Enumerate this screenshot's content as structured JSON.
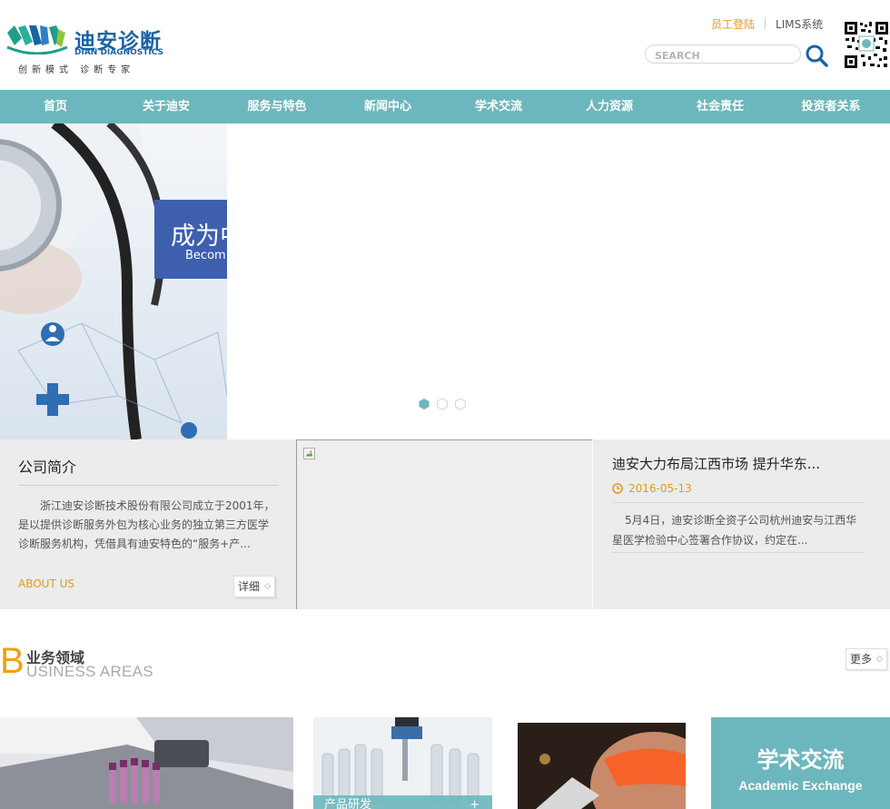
{
  "header": {
    "logo_cn": "迪安诊断",
    "logo_en": "DIAN DIAGNOSTICS",
    "slogan": "创新模式 诊断专家",
    "staff_login": "员工登陆",
    "lims": "LIMS系统",
    "search_placeholder": "SEARCH"
  },
  "nav": {
    "items": [
      "首页",
      "关于迪安",
      "服务与特色",
      "新闻中心",
      "学术交流",
      "人力资源",
      "社会责任",
      "投资者关系"
    ]
  },
  "banner": {
    "caption_cn": "成为中",
    "caption_en": "Becom",
    "slides": 3,
    "active_slide": 1
  },
  "about": {
    "title": "公司简介",
    "text": "浙江迪安诊断技术股份有限公司成立于2001年，是以提供诊断服务外包为核心业务的独立第三方医学诊断服务机构，凭借具有迪安特色的“服务+产...",
    "en_label": "ABOUT US",
    "detail_label": "详细"
  },
  "news": {
    "title": "迪安大力布局江西市场 提升华东...",
    "date": "2016-05-13",
    "text": "5月4日，迪安诊断全资子公司杭州迪安与江西华星医学检验中心签署合作协议，约定在..."
  },
  "business": {
    "letter": "B",
    "title_cn": "业务领域",
    "title_en": "USINESS AREAS",
    "more_label": "更多",
    "card2_caption": "产品研发",
    "card2_plus": "+",
    "card4_cn": "学术交流",
    "card4_en": "Academic Exchange"
  },
  "colors": {
    "nav": "#6cb7bd",
    "accent": "#e6981e",
    "brand": "#1a63a6",
    "banner_caption": "#3d5fae"
  }
}
